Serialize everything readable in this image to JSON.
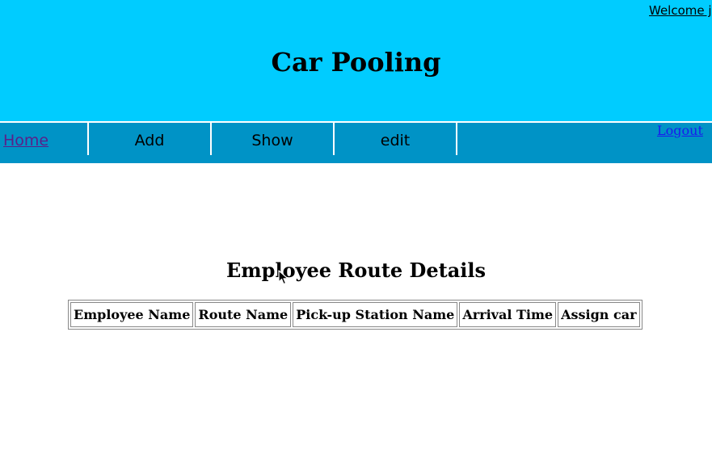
{
  "header": {
    "welcome_text": "Welcome j",
    "site_title": "Car Pooling",
    "background_color": "#00ccff"
  },
  "nav": {
    "items": [
      {
        "label": "Home"
      },
      {
        "label": "Add"
      },
      {
        "label": "Show"
      },
      {
        "label": "edit"
      }
    ],
    "logout_label": "Logout",
    "background_color": "#0093c6"
  },
  "main": {
    "heading": "Employee Route Details",
    "table": {
      "columns": [
        "Employee Name",
        "Route Name",
        "Pick-up Station Name",
        "Arrival Time",
        "Assign car"
      ],
      "rows": []
    }
  },
  "icons": {
    "cursor": "mouse-pointer-icon"
  }
}
